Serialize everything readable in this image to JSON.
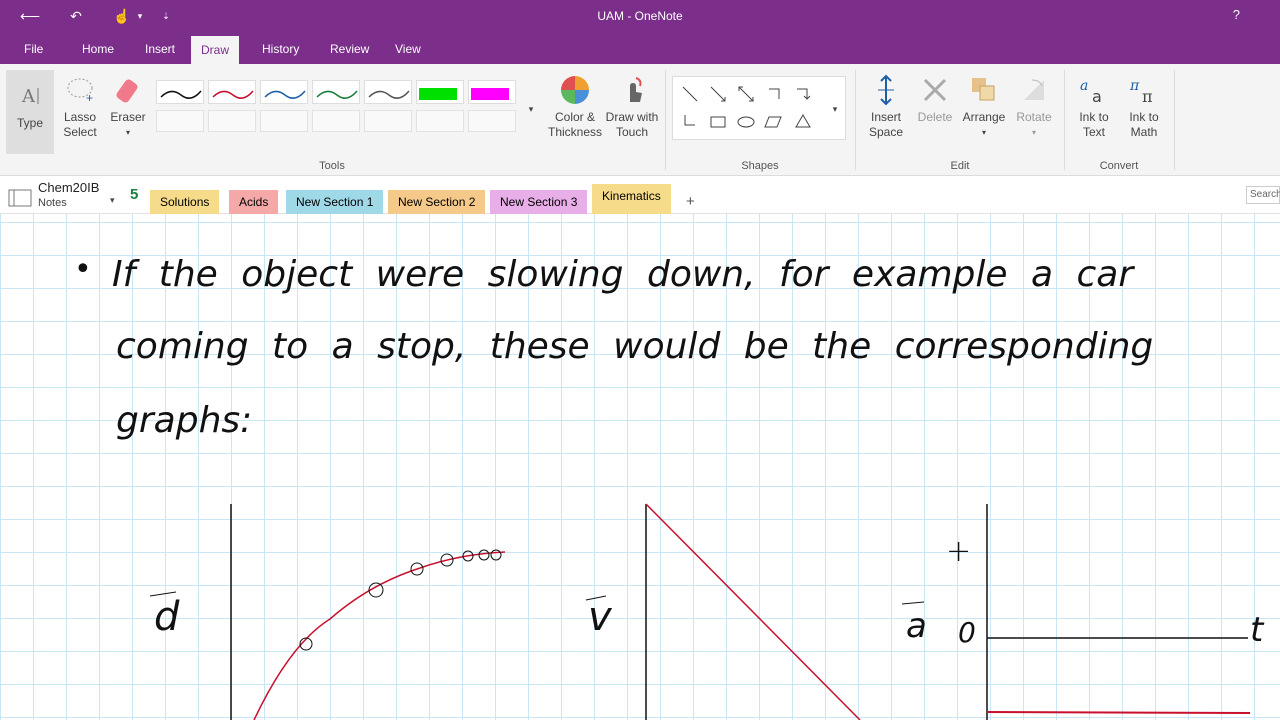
{
  "window": {
    "title": "UAM - OneNote",
    "help": "?"
  },
  "menu": {
    "items": [
      "File",
      "Home",
      "Insert",
      "Draw",
      "History",
      "Review",
      "View"
    ],
    "active": "Draw"
  },
  "ribbon": {
    "type_label": "Type",
    "lasso_label": "Lasso Select",
    "eraser_label": "Eraser",
    "color_label": "Color & Thickness",
    "draw_touch_label": "Draw with Touch",
    "insert_space_label": "Insert Space",
    "delete_label": "Delete",
    "arrange_label": "Arrange",
    "rotate_label": "Rotate",
    "ink_text_label": "Ink to Text",
    "ink_math_label": "Ink to Math",
    "groups": {
      "tools": "Tools",
      "shapes": "Shapes",
      "edit": "Edit",
      "convert": "Convert"
    },
    "pen_colors": [
      "#111111",
      "#c8102e",
      "#1f5fa8",
      "#1a7f3c",
      "#555555",
      "#00e000",
      "#ff00ff"
    ]
  },
  "notebook": {
    "name": "Chem20IB",
    "sub": "Notes",
    "sync_icon": "5"
  },
  "sections": [
    {
      "label": "Solutions",
      "color": "#f6dc8a"
    },
    {
      "label": "Acids",
      "color": "#f4a9a8"
    },
    {
      "label": "New Section 1",
      "color": "#9fd8e6"
    },
    {
      "label": "New Section 2",
      "color": "#f5c98a"
    },
    {
      "label": "New Section 3",
      "color": "#e8aee8"
    },
    {
      "label": "Kinematics",
      "color": "#f6dc8a",
      "active": true
    }
  ],
  "add_section": "+",
  "search_placeholder": "Search",
  "note": {
    "bullet": "•",
    "line1": "If the object were slowing down, for example a car",
    "line2": "coming to a stop, these would be the corresponding",
    "line3": "graphs:"
  },
  "graphs": {
    "d_label": "d",
    "v_label": "v",
    "a_label": "a",
    "plus_label": "+",
    "zero_label": "0",
    "t_label": "t"
  }
}
